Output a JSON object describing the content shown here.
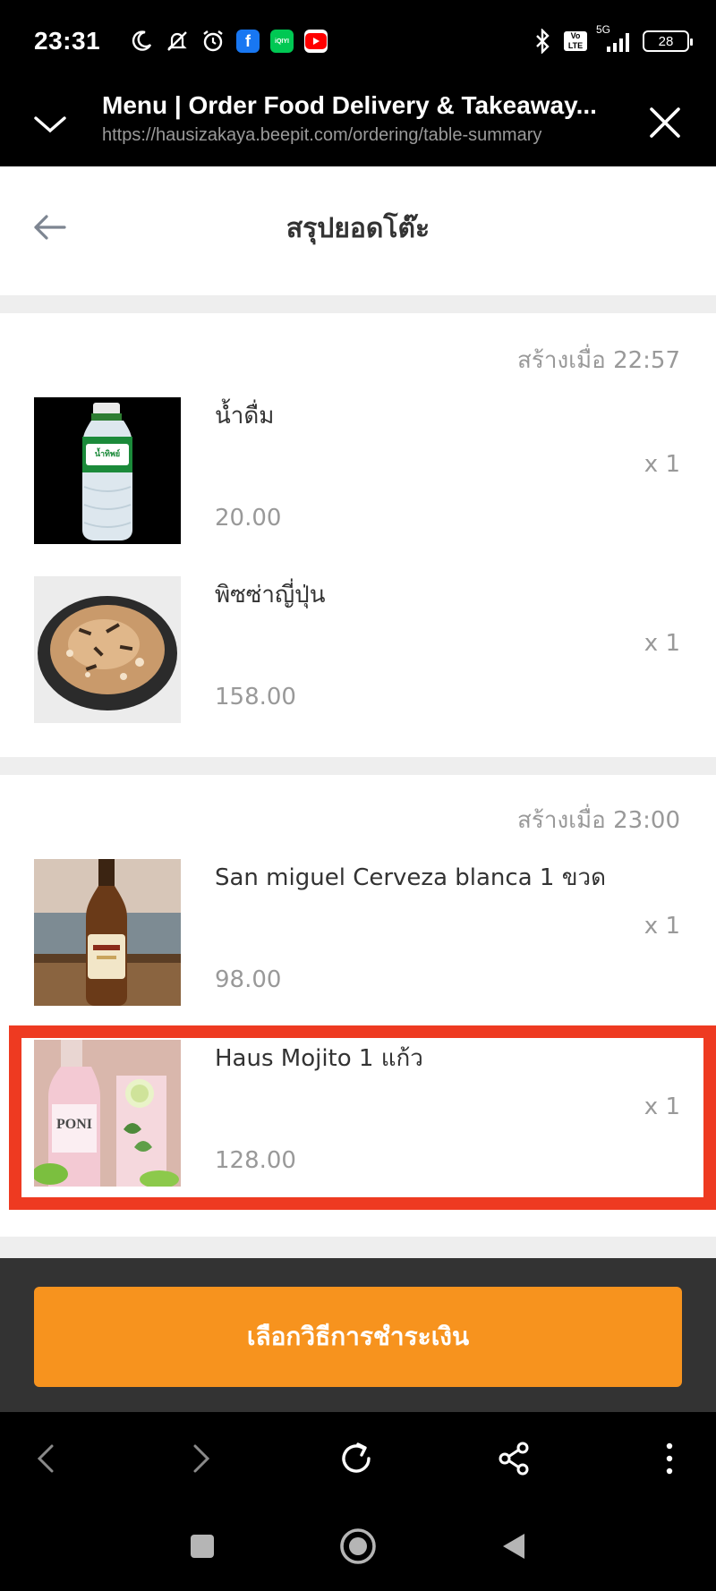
{
  "status_bar": {
    "time": "23:31",
    "battery": "28",
    "network": "5G",
    "volte": "Vo LTE",
    "icons": [
      "moon-icon",
      "mute-icon",
      "alarm-icon",
      "facebook-icon",
      "iqiyi-icon",
      "youtube-icon",
      "bluetooth-icon",
      "signal-icon"
    ],
    "app_badges": {
      "facebook": "f",
      "iqiyi": "iQIYI"
    }
  },
  "browser": {
    "title": "Menu | Order Food Delivery & Takeaway...",
    "url": "https://hausizakaya.beepit.com/ordering/table-summary"
  },
  "page": {
    "title": "สรุปยอดโต๊ะ"
  },
  "orders": [
    {
      "created": "สร้างเมื่อ 22:57",
      "items": [
        {
          "name": "น้ำดื่ม",
          "qty": "x 1",
          "price": "20.00",
          "image": "water-bottle-image",
          "image_label": "น้ำทิพย์"
        },
        {
          "name": "พิซซ่าญี่ปุ่น",
          "qty": "x 1",
          "price": "158.00",
          "image": "japanese-pizza-image"
        }
      ]
    },
    {
      "created": "สร้างเมื่อ 23:00",
      "items": [
        {
          "name": "San miguel Cerveza blanca 1 ขวด",
          "qty": "x 1",
          "price": "98.00",
          "image": "beer-bottle-image"
        },
        {
          "name": "Haus Mojito 1 แก้ว",
          "qty": "x 1",
          "price": "128.00",
          "image": "mojito-image",
          "image_label": "PONI"
        }
      ]
    }
  ],
  "action": {
    "pay_label": "เลือกวิธีการชำระเงิน"
  },
  "colors": {
    "accent": "#f7931e",
    "highlight": "#ee3a21"
  }
}
